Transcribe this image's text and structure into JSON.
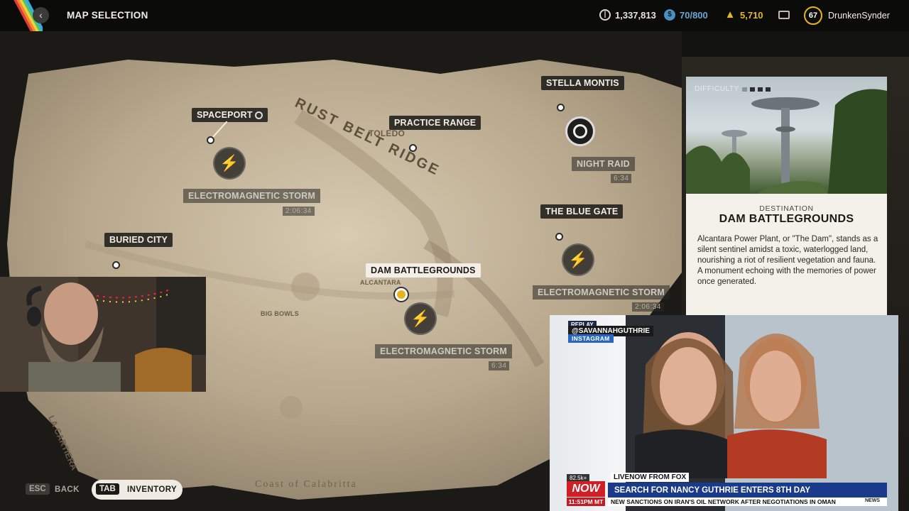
{
  "header": {
    "title": "MAP SELECTION",
    "currency": "1,337,813",
    "tokens": "70/800",
    "credits": "5,710",
    "level": "67",
    "username": "DrunkenSynder"
  },
  "map": {
    "region_labels": [
      "RUST BELT RIDGE",
      "TOLEDO",
      "ALCANTARA",
      "BIG BOWLS",
      "LA CARTIERA",
      "Coast of Calabritta"
    ],
    "locations": [
      {
        "name": "SPACEPORT",
        "condition": "ELECTROMAGNETIC STORM",
        "timer": "2:06:34"
      },
      {
        "name": "PRACTICE RANGE"
      },
      {
        "name": "STELLA MONTIS",
        "condition": "NIGHT RAID",
        "timer": "6:34"
      },
      {
        "name": "THE BLUE GATE",
        "condition": "ELECTROMAGNETIC STORM",
        "timer": "2:06:34"
      },
      {
        "name": "BURIED CITY"
      },
      {
        "name": "DAM BATTLEGROUNDS",
        "condition": "ELECTROMAGNETIC STORM",
        "timer": "6:34",
        "selected": true
      }
    ]
  },
  "destination": {
    "difficulty_label": "DIFFICULTY",
    "kicker": "DESTINATION",
    "name": "DAM BATTLEGROUNDS",
    "description": "Alcantara Power Plant, or \"The Dam\", stands as a silent sentinel amidst a toxic, waterlogged land, nourishing a riot of resilient vegetation and fauna. A monument echoing with the memories of power once generated."
  },
  "news_overlay": {
    "replay": "REPLAY",
    "handle": "@SAVANNAHGUTHRIE",
    "source": "INSTAGRAM",
    "views": "82.5k+",
    "live_tag": "LIVENOW FROM FOX",
    "now": "NOW",
    "headline": "SEARCH FOR NANCY GUTHRIE ENTERS 8TH DAY",
    "time": "11:51PM MT",
    "ticker": "NEW SANCTIONS ON IRAN'S OIL NETWORK AFTER NEGOTIATIONS IN OMAN",
    "network": "NEWS"
  },
  "controls": {
    "esc_key": "ESC",
    "back_label": "BACK",
    "tab_key": "TAB",
    "inventory_label": "INVENTORY"
  },
  "colors": {
    "accent_gold": "#e8b41c",
    "panel_bg": "#f4f1ea",
    "label_bg": "#141412"
  }
}
